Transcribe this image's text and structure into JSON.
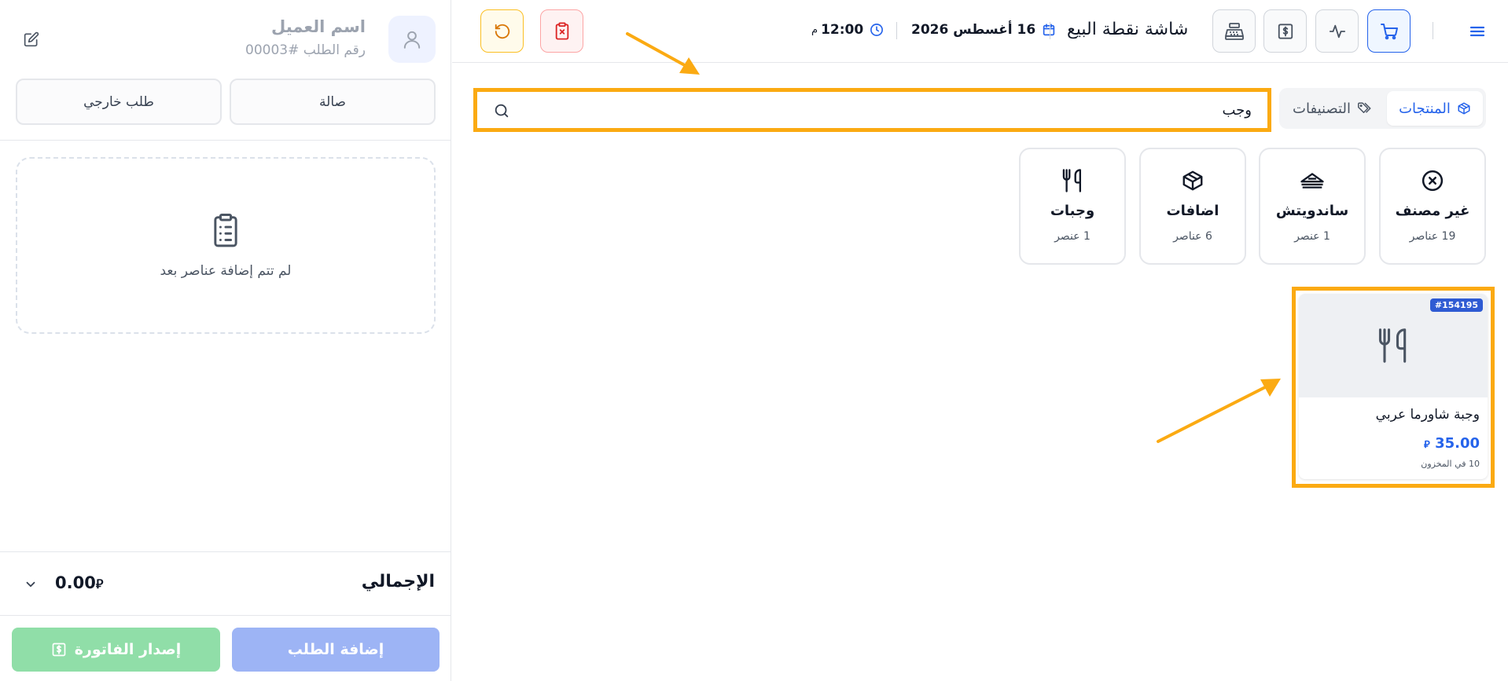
{
  "customer": {
    "name": "اسم العميل",
    "order_number": "رقم الطلب #00003"
  },
  "order_types": {
    "hall": "صالة",
    "external": "طلب خارجي"
  },
  "cart": {
    "empty_message": "لم تتم إضافة عناصر بعد",
    "total_label": "الإجمالي",
    "total_value": "0.00",
    "add_order_label": "إضافة الطلب",
    "issue_invoice_label": "إصدار الفاتورة"
  },
  "header": {
    "title": "شاشة نقطة البيع",
    "date": "16 أغسطس 2026",
    "time": "12:00",
    "time_suffix": "م"
  },
  "tabs": {
    "products": "المنتجات",
    "categories": "التصنيفات"
  },
  "search": {
    "value": "وجب"
  },
  "categories": [
    {
      "name": "غير مصنف",
      "count": "19 عناصر",
      "icon": "x-circle-icon"
    },
    {
      "name": "ساندويتش",
      "count": "1 عنصر",
      "icon": "sandwich-icon"
    },
    {
      "name": "اضافات",
      "count": "6 عناصر",
      "icon": "box-icon"
    },
    {
      "name": "وجبات",
      "count": "1 عنصر",
      "icon": "utensils-icon"
    }
  ],
  "products": [
    {
      "badge": "#154195",
      "name": "وجبة شاورما عربي",
      "price": "35.00",
      "stock": "10 في المخزون",
      "icon": "utensils-icon"
    }
  ],
  "colors": {
    "accent": "#2563eb",
    "highlight": "#fbaa12",
    "add_order_disabled": "#9db4f5",
    "invoice_disabled": "#90dea8"
  }
}
